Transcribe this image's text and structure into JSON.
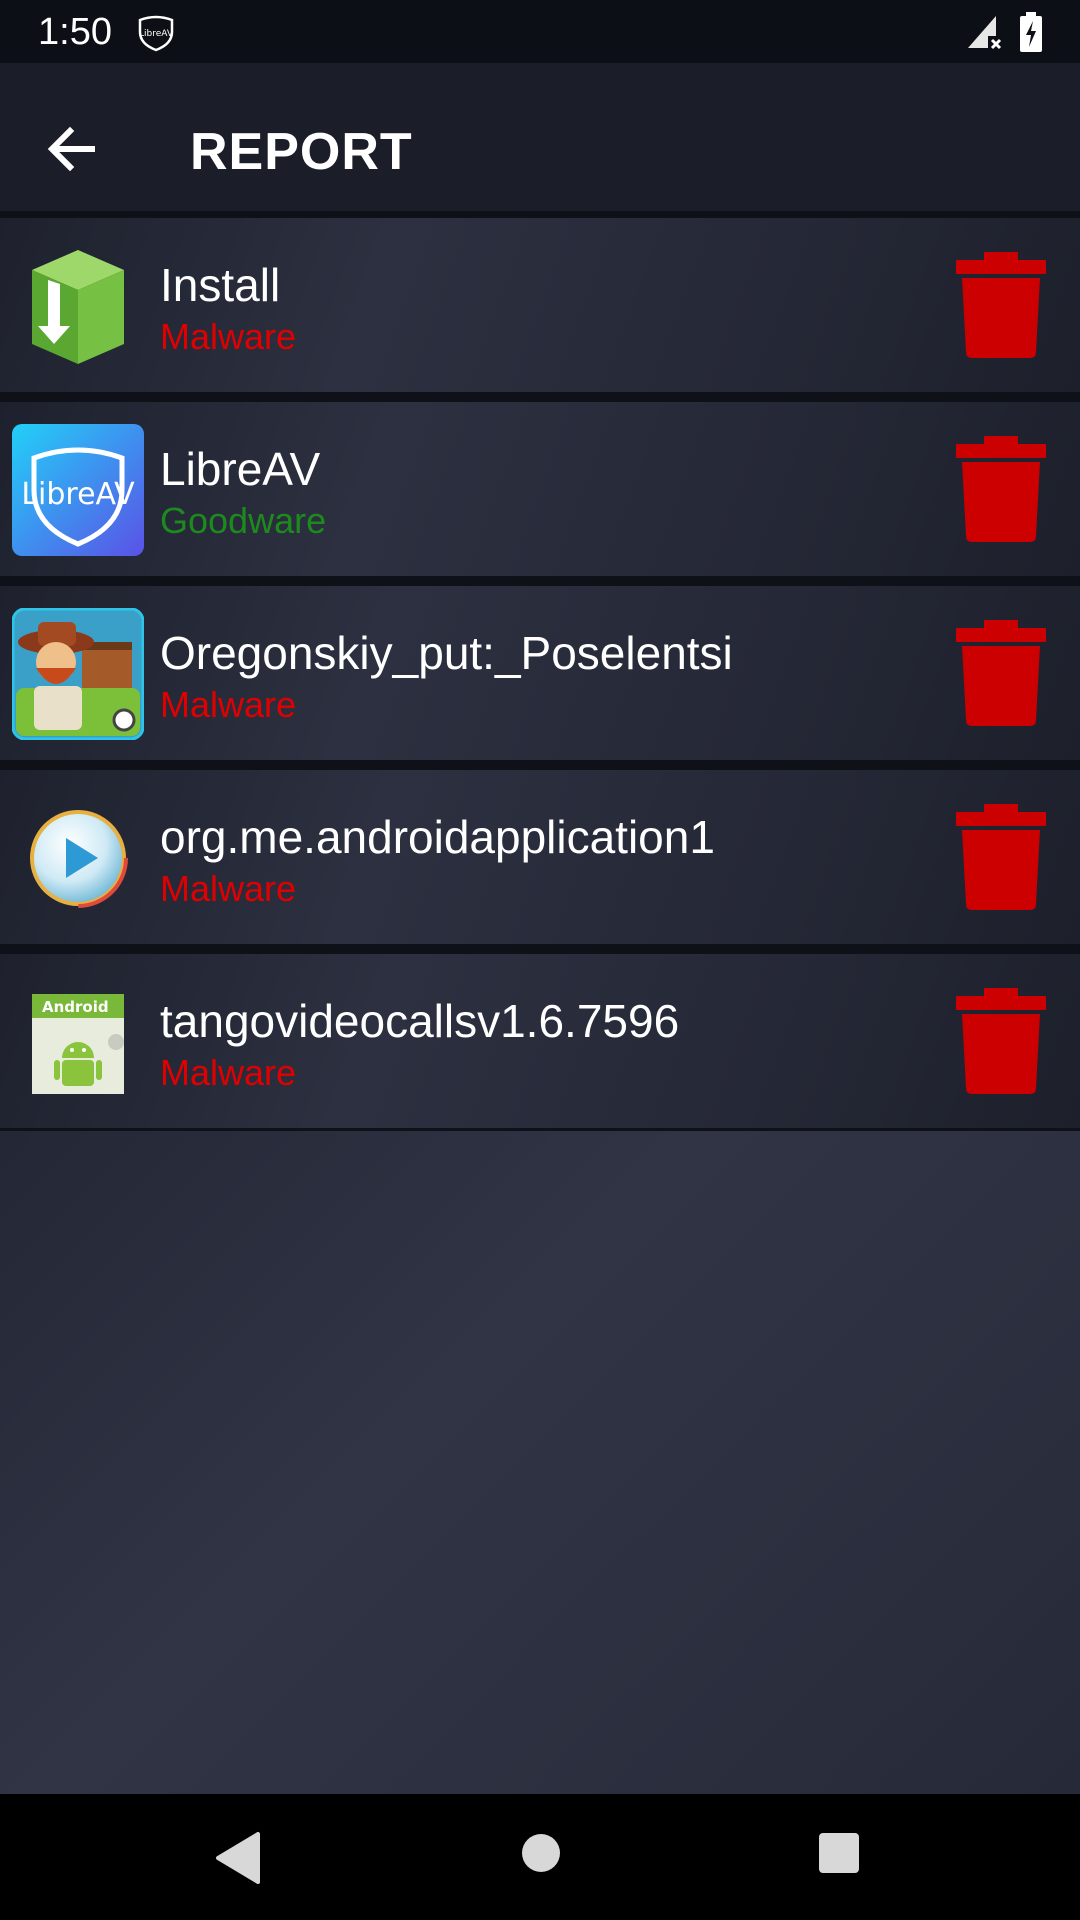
{
  "status_bar": {
    "time": "1:50",
    "notification_icon": "libreav-shield-icon",
    "notification_icon_text": "LibreAV",
    "signal_icon": "signal-no-data-icon",
    "battery_icon": "battery-charging-icon"
  },
  "app_bar": {
    "back_icon": "arrow-left-icon",
    "title": "REPORT"
  },
  "items": [
    {
      "name": "Install",
      "status": "Malware",
      "status_color": "#e00000",
      "icon": "install-box-icon"
    },
    {
      "name": "LibreAV",
      "status": "Goodware",
      "status_color": "#1d8a1d",
      "icon": "libreav-shield-icon",
      "icon_text": "LibreAV"
    },
    {
      "name": "Oregonskiy_put:_Poselentsi",
      "status": "Malware",
      "status_color": "#e00000",
      "icon": "game-cowboy-icon"
    },
    {
      "name": "org.me.androidapplication1",
      "status": "Malware",
      "status_color": "#e00000",
      "icon": "media-play-icon"
    },
    {
      "name": "tangovideocallsv1.6.7596",
      "status": "Malware",
      "status_color": "#e00000",
      "icon": "android-default-icon",
      "icon_text": "Android"
    }
  ],
  "delete_icon": "trash-icon",
  "colors": {
    "delete": "#cc0000",
    "malware": "#e00000",
    "goodware": "#1d8a1d"
  },
  "nav_bar": {
    "back": "triangle-back-icon",
    "home": "circle-home-icon",
    "recents": "square-recents-icon"
  }
}
